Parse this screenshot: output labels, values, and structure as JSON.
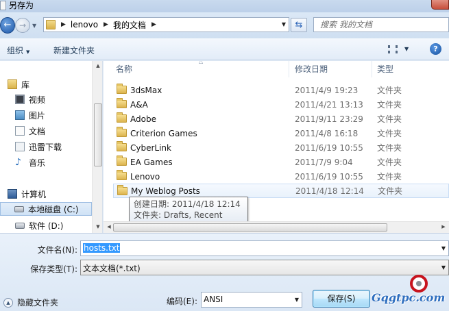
{
  "window": {
    "title": "另存为"
  },
  "address_bar": {
    "crumbs": [
      "lenovo",
      "我的文档"
    ]
  },
  "search": {
    "placeholder": "搜索 我的文档"
  },
  "toolbar": {
    "organize_label": "组织",
    "new_folder_label": "新建文件夹"
  },
  "nav_pane": {
    "library_header": "库",
    "libraries": [
      {
        "label": "视频",
        "icon": "video-library-icon"
      },
      {
        "label": "图片",
        "icon": "picture-library-icon"
      },
      {
        "label": "文档",
        "icon": "document-library-icon"
      },
      {
        "label": "迅雷下载",
        "icon": "download-library-icon"
      },
      {
        "label": "音乐",
        "icon": "music-library-icon"
      }
    ],
    "computer_header": "计算机",
    "drives": [
      {
        "label": "本地磁盘 (C:)",
        "selected": true
      },
      {
        "label": "软件 (D:)",
        "selected": false
      }
    ]
  },
  "file_list": {
    "columns": {
      "name": "名称",
      "modified": "修改日期",
      "type": "类型"
    },
    "rows": [
      {
        "name": "3dsMax",
        "modified": "2011/4/9 19:23",
        "type": "文件夹"
      },
      {
        "name": "A&A",
        "modified": "2011/4/21 13:13",
        "type": "文件夹"
      },
      {
        "name": "Adobe",
        "modified": "2011/9/11 23:29",
        "type": "文件夹"
      },
      {
        "name": "Criterion Games",
        "modified": "2011/4/8 16:18",
        "type": "文件夹"
      },
      {
        "name": "CyberLink",
        "modified": "2011/6/19 10:55",
        "type": "文件夹"
      },
      {
        "name": "EA Games",
        "modified": "2011/7/9 9:04",
        "type": "文件夹"
      },
      {
        "name": "Lenovo",
        "modified": "2011/6/19 10:55",
        "type": "文件夹"
      },
      {
        "name": "My Weblog Posts",
        "modified": "2011/4/18 12:14",
        "type": "文件夹",
        "hovered": true
      }
    ],
    "tooltip": {
      "created": "创建日期: 2011/4/18 12:14",
      "contents": "文件夹: Drafts, Recent Posts"
    }
  },
  "save_form": {
    "filename_label": "文件名(N):",
    "filename_value": "hosts.txt",
    "filetype_label": "保存类型(T):",
    "filetype_value": "文本文档(*.txt)",
    "encoding_label": "编码(E):",
    "encoding_value": "ANSI",
    "save_label": "保存(S)",
    "hide_folders_label": "隐藏文件夹"
  },
  "watermark": {
    "text": "Gqgtpc.com"
  }
}
